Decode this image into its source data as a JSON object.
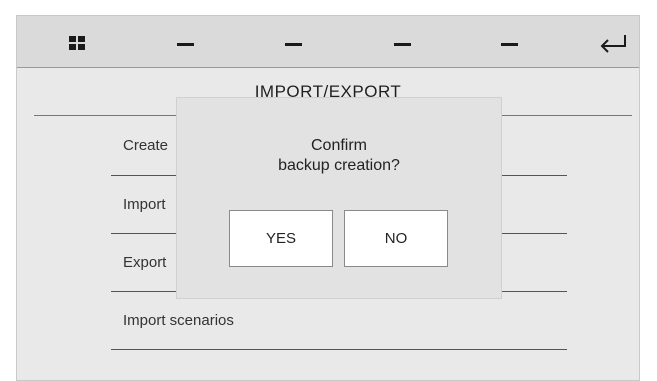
{
  "topbar": {
    "icons": [
      "grid-icon",
      "dash-icon",
      "dash-icon",
      "dash-icon",
      "dash-icon",
      "return-arrow-icon"
    ]
  },
  "page": {
    "title": "IMPORT/EXPORT"
  },
  "menu": {
    "items": [
      {
        "label": "Create"
      },
      {
        "label": "Import"
      },
      {
        "label": "Export"
      },
      {
        "label": "Import scenarios"
      }
    ]
  },
  "dialog": {
    "message_line1": "Confirm",
    "message_line2": "backup creation?",
    "yes_label": "YES",
    "no_label": "NO"
  },
  "colors": {
    "background": "#e9e9e9",
    "topbar": "#dadada",
    "dialog": "#e2e2e2",
    "button": "#ffffff",
    "text": "#222222",
    "scroll_thumb": "#111111"
  }
}
